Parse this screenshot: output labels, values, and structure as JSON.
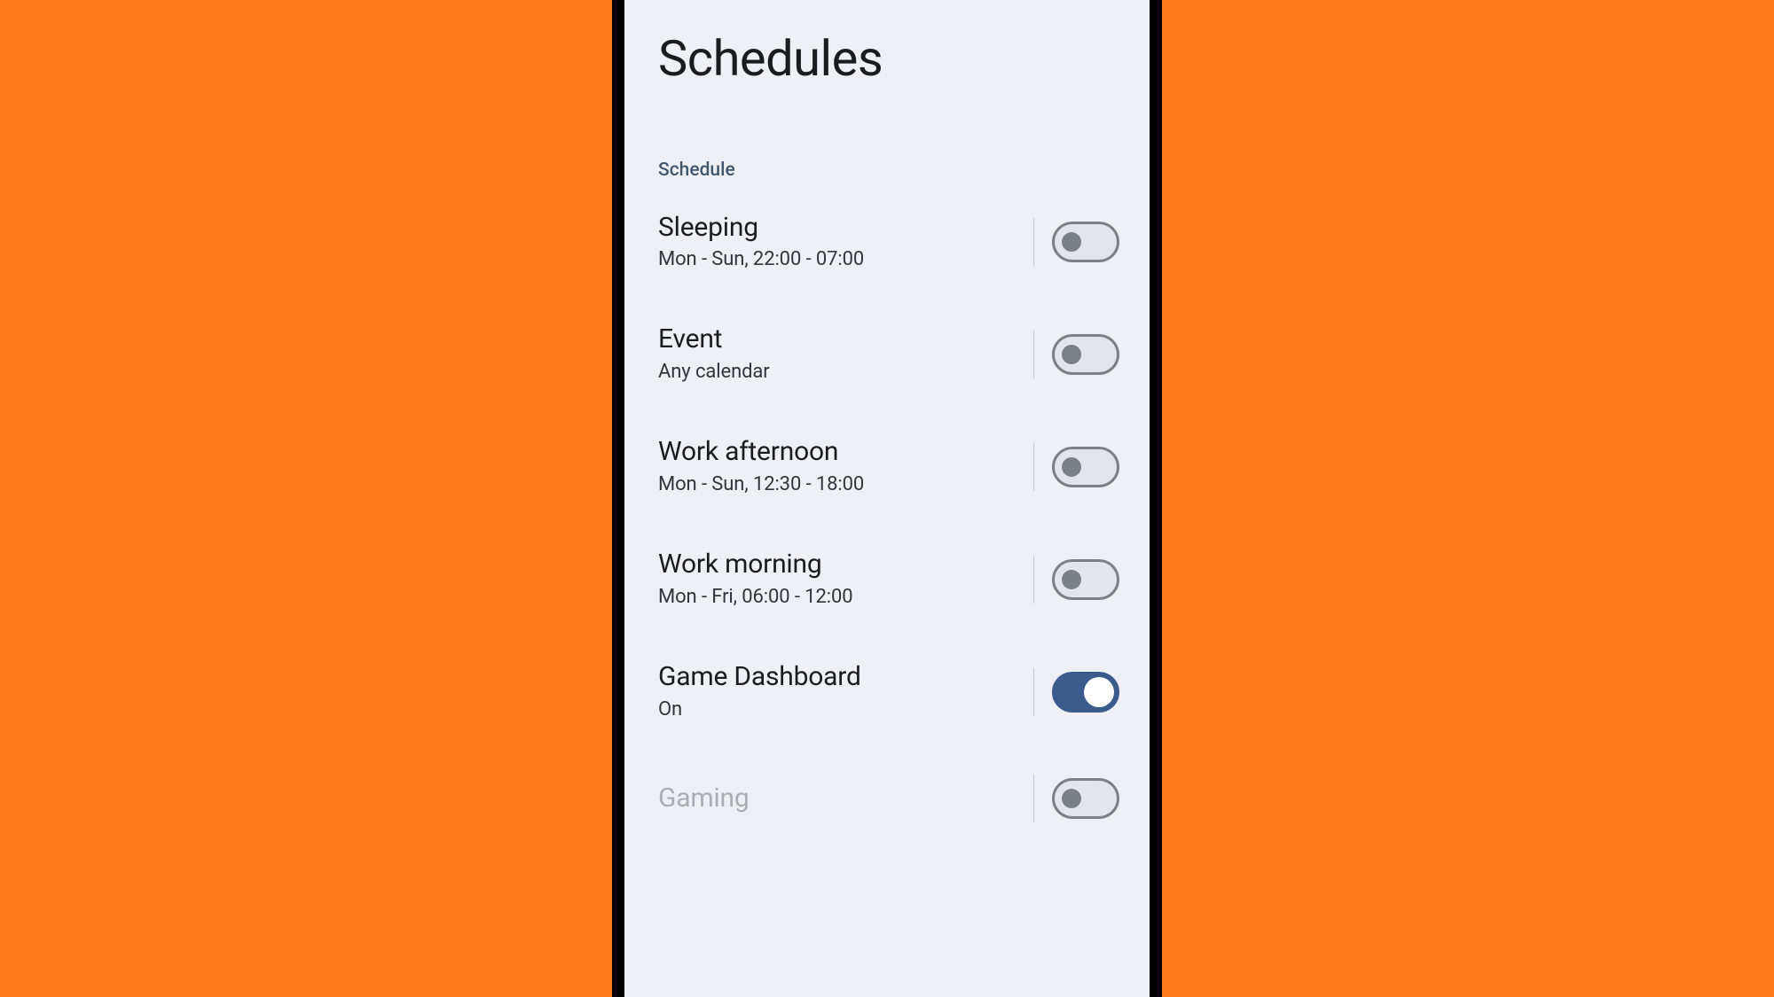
{
  "page": {
    "title": "Schedules",
    "section_label": "Schedule"
  },
  "items": [
    {
      "title": "Sleeping",
      "sub": "Mon - Sun, 22:00 - 07:00",
      "on": false,
      "dim": false
    },
    {
      "title": "Event",
      "sub": "Any calendar",
      "on": false,
      "dim": false
    },
    {
      "title": "Work afternoon",
      "sub": "Mon - Sun, 12:30 - 18:00",
      "on": false,
      "dim": false
    },
    {
      "title": "Work morning",
      "sub": "Mon - Fri, 06:00 - 12:00",
      "on": false,
      "dim": false
    },
    {
      "title": "Game Dashboard",
      "sub": "On",
      "on": true,
      "dim": false
    },
    {
      "title": "Gaming",
      "sub": "",
      "on": false,
      "dim": true
    }
  ]
}
